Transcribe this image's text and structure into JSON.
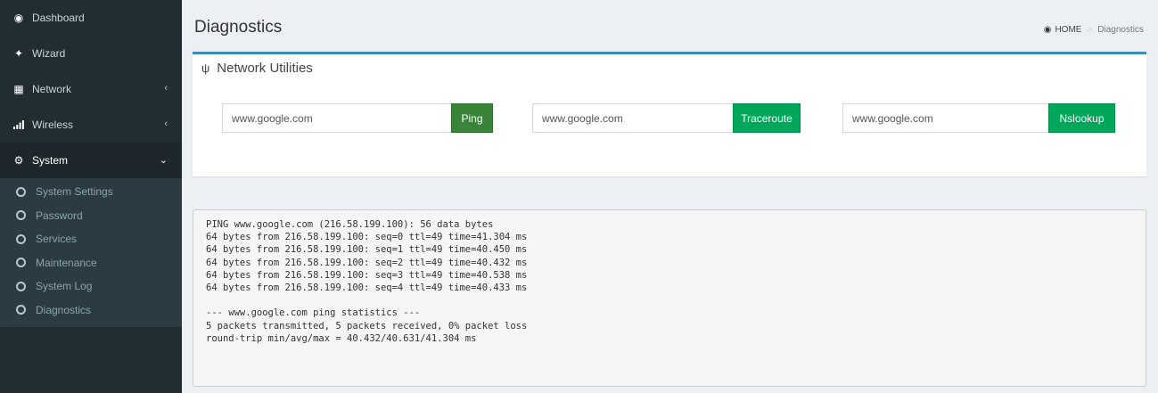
{
  "sidebar": {
    "items": [
      {
        "label": "Dashboard",
        "icon": "dashboard-icon"
      },
      {
        "label": "Wizard",
        "icon": "wand-icon"
      },
      {
        "label": "Network",
        "icon": "sitemap-icon"
      },
      {
        "label": "Wireless",
        "icon": "signal-icon"
      },
      {
        "label": "System",
        "icon": "gear-icon"
      }
    ],
    "submenu": [
      {
        "label": "System Settings"
      },
      {
        "label": "Password"
      },
      {
        "label": "Services"
      },
      {
        "label": "Maintenance"
      },
      {
        "label": "System Log"
      },
      {
        "label": "Diagnostics"
      }
    ]
  },
  "header": {
    "title": "Diagnostics",
    "breadcrumb_home": "HOME",
    "breadcrumb_current": "Diagnostics"
  },
  "utilities": {
    "title": "Network Utilities",
    "ping": {
      "value": "www.google.com",
      "button": "Ping"
    },
    "traceroute": {
      "value": "www.google.com",
      "button": "Traceroute"
    },
    "nslookup": {
      "value": "www.google.com",
      "button": "Nslookup"
    }
  },
  "output": {
    "text": "PING www.google.com (216.58.199.100): 56 data bytes\n64 bytes from 216.58.199.100: seq=0 ttl=49 time=41.304 ms\n64 bytes from 216.58.199.100: seq=1 ttl=49 time=40.450 ms\n64 bytes from 216.58.199.100: seq=2 ttl=49 time=40.432 ms\n64 bytes from 216.58.199.100: seq=3 ttl=49 time=40.538 ms\n64 bytes from 216.58.199.100: seq=4 ttl=49 time=40.433 ms\n\n--- www.google.com ping statistics ---\n5 packets transmitted, 5 packets received, 0% packet loss\nround-trip min/avg/max = 40.432/40.631/41.304 ms"
  },
  "colors": {
    "sidebar_bg": "#222d32",
    "accent": "#3c8dbc",
    "ping_button": "#398439",
    "success_button": "#00a65a"
  }
}
